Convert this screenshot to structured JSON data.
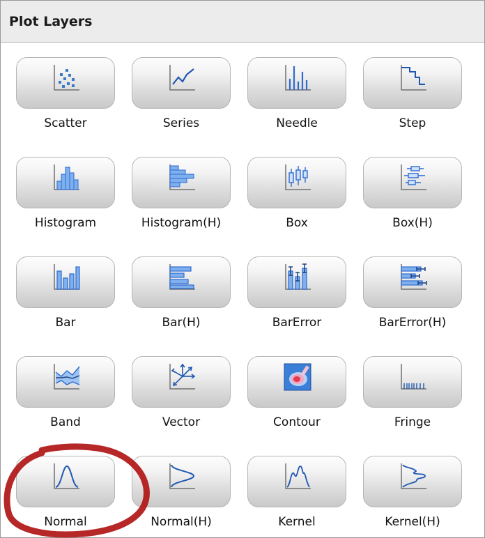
{
  "panel": {
    "title": "Plot Layers"
  },
  "colors": {
    "accent": "#3a78c8",
    "annotation": "#b01818"
  },
  "layers": [
    {
      "label": "Scatter",
      "icon": "scatter-icon"
    },
    {
      "label": "Series",
      "icon": "series-icon"
    },
    {
      "label": "Needle",
      "icon": "needle-icon"
    },
    {
      "label": "Step",
      "icon": "step-icon"
    },
    {
      "label": "Histogram",
      "icon": "histogram-icon"
    },
    {
      "label": "Histogram(H)",
      "icon": "histogram-h-icon"
    },
    {
      "label": "Box",
      "icon": "box-icon"
    },
    {
      "label": "Box(H)",
      "icon": "box-h-icon"
    },
    {
      "label": "Bar",
      "icon": "bar-icon"
    },
    {
      "label": "Bar(H)",
      "icon": "bar-h-icon"
    },
    {
      "label": "BarError",
      "icon": "bar-error-icon"
    },
    {
      "label": "BarError(H)",
      "icon": "bar-error-h-icon"
    },
    {
      "label": "Band",
      "icon": "band-icon"
    },
    {
      "label": "Vector",
      "icon": "vector-icon"
    },
    {
      "label": "Contour",
      "icon": "contour-icon"
    },
    {
      "label": "Fringe",
      "icon": "fringe-icon"
    },
    {
      "label": "Normal",
      "icon": "normal-icon"
    },
    {
      "label": "Normal(H)",
      "icon": "normal-h-icon"
    },
    {
      "label": "Kernel",
      "icon": "kernel-icon"
    },
    {
      "label": "Kernel(H)",
      "icon": "kernel-h-icon"
    }
  ],
  "highlighted_layer": "Normal"
}
